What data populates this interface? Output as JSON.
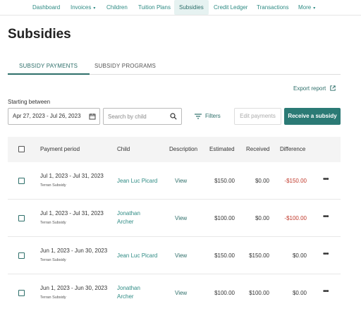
{
  "nav": {
    "items": [
      {
        "label": "Dashboard"
      },
      {
        "label": "Invoices",
        "caret": "▾"
      },
      {
        "label": "Children"
      },
      {
        "label": "Tuition Plans"
      },
      {
        "label": "Subsidies"
      },
      {
        "label": "Credit Ledger"
      },
      {
        "label": "Transactions"
      },
      {
        "label": "More",
        "caret": "▾"
      }
    ],
    "active": "Subsidies",
    "accent": "#2e8b84"
  },
  "page": {
    "title": "Subsidies"
  },
  "tabs": [
    {
      "label": "SUBSIDY PAYMENTS",
      "active": true
    },
    {
      "label": "SUBSIDY PROGRAMS",
      "active": false
    }
  ],
  "toolbar": {
    "export_label": "Export report",
    "starting_label": "Starting between",
    "date_range": "Apr 27, 2023 - Jul 26, 2023",
    "search_placeholder": "Search by child",
    "filters_label": "Filters",
    "edit_label": "Edit payments",
    "receive_label": "Receive a subsidy",
    "primary_color": "#2b7a75"
  },
  "table": {
    "headers": {
      "period": "Payment period",
      "child": "Child",
      "description": "Description",
      "estimated": "Estimated",
      "received": "Received",
      "difference": "Difference"
    },
    "rows": [
      {
        "period": "Jul 1, 2023 - Jul 31, 2023",
        "program": "Terran Subsidy",
        "child": "Jean Luc Picard",
        "description": "View",
        "estimated": "$150.00",
        "received": "$0.00",
        "difference": "-$150.00",
        "negative": true,
        "menu": "•••"
      },
      {
        "period": "Jul 1, 2023 - Jul 31, 2023",
        "program": "Terran Subsidy",
        "child": "Jonathan Archer",
        "description": "View",
        "estimated": "$100.00",
        "received": "$0.00",
        "difference": "-$100.00",
        "negative": true,
        "menu": "•••"
      },
      {
        "period": "Jun 1, 2023 - Jun 30, 2023",
        "program": "Terran Subsidy",
        "child": "Jean Luc Picard",
        "description": "View",
        "estimated": "$150.00",
        "received": "$150.00",
        "difference": "$0.00",
        "negative": false,
        "menu": "•••"
      },
      {
        "period": "Jun 1, 2023 - Jun 30, 2023",
        "program": "Terran Subsidy",
        "child": "Jonathan Archer",
        "description": "View",
        "estimated": "$100.00",
        "received": "$100.00",
        "difference": "$0.00",
        "negative": false,
        "menu": "•••"
      }
    ]
  }
}
